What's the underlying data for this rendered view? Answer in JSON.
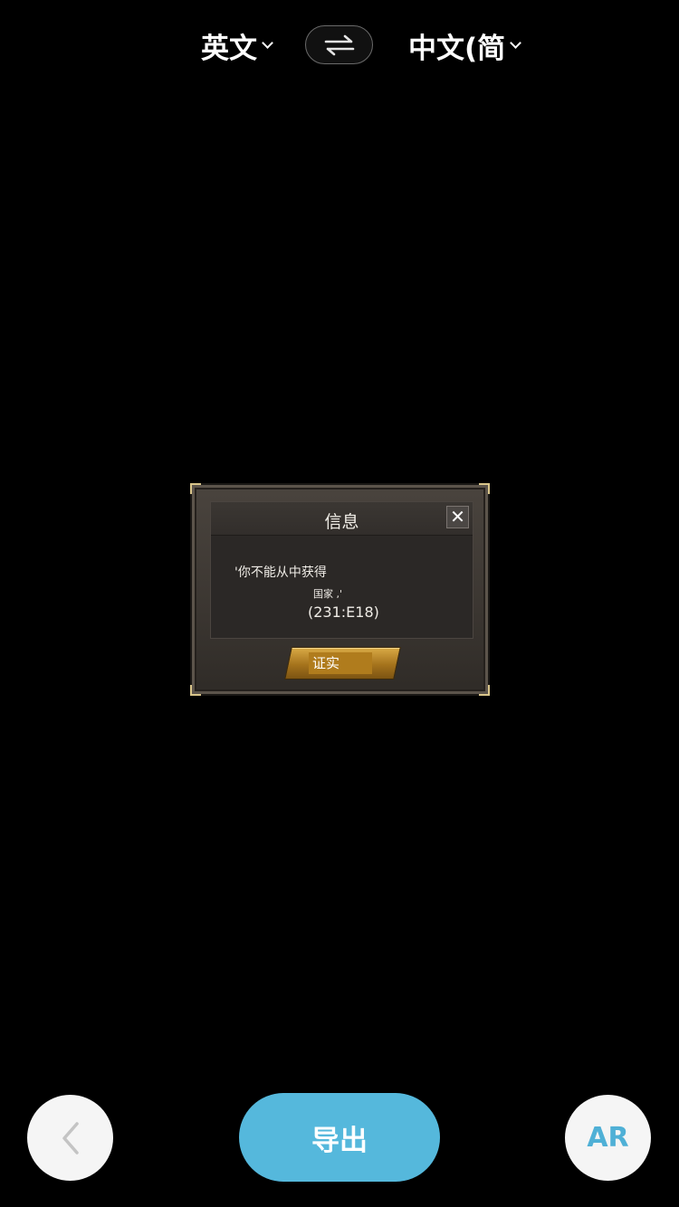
{
  "language_bar": {
    "source_language": "英文",
    "target_language": "中文(简",
    "swap_icon": "swap-arrows-icon"
  },
  "dialog": {
    "title": "信息",
    "close_symbol": "✕",
    "line1": "'你不能从中获得",
    "line2": "国家         ,'",
    "line3": "(231:E18)",
    "confirm_label": "证实"
  },
  "bottom_bar": {
    "back_icon": "chevron-left-icon",
    "export_label": "导出",
    "ar_label": "AR"
  },
  "colors": {
    "background": "#000000",
    "accent": "#55b8dc",
    "ar_text": "#4fb0d6",
    "gold": "#c9973a"
  }
}
